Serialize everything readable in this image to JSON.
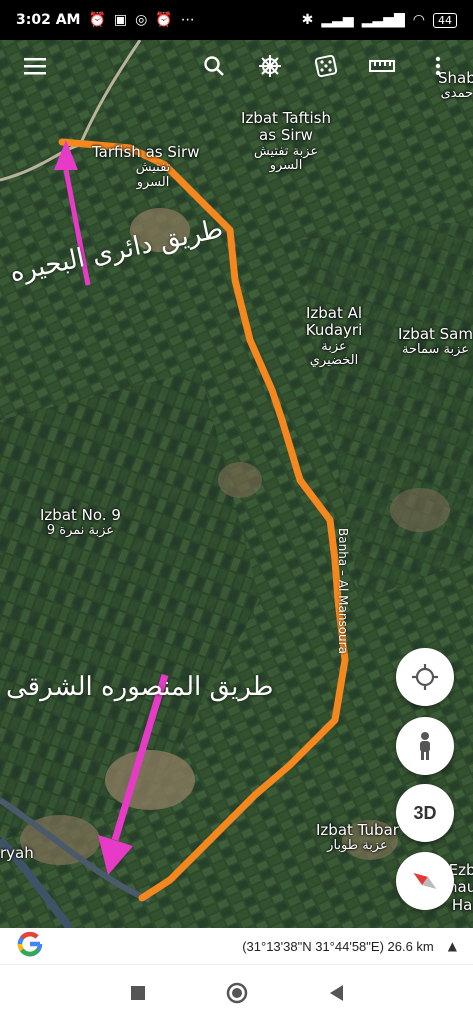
{
  "status": {
    "time": "3:02 AM",
    "left_icons": [
      "alarm-icon",
      "calendar-icon",
      "instagram-icon",
      "alarm-icon",
      "more-icon"
    ],
    "battery": "44"
  },
  "toolbar": {
    "menu": "menu-icon",
    "search": "search-icon",
    "voyager": "ship-wheel-icon",
    "feeling_lucky": "dice-icon",
    "measure": "ruler-icon",
    "more": "more-vert-icon"
  },
  "places": [
    {
      "en": "Tarfish as Sirw",
      "ar": "تفتيش السرو"
    },
    {
      "en": "Izbat Taftish as Sirw",
      "ar": "عزبة تفتيش السرو"
    },
    {
      "en": "Izbat Al Kudayri",
      "ar": "عزبة الخضيري"
    },
    {
      "en": "Izbat Sam",
      "ar": "عزبة سماحة"
    },
    {
      "en": "Izbat No. 9",
      "ar": "عزبة نمرة 9"
    },
    {
      "en": "Izbat Tubar",
      "ar": "عزبة طوبار"
    },
    {
      "en": "Shab",
      "ar": "حمدى"
    },
    {
      "en": "ryah",
      "ar": ""
    },
    {
      "en": "Ezb",
      "ar": ""
    },
    {
      "en": "hau",
      "ar": ""
    },
    {
      "en": "Ha",
      "ar": ""
    }
  ],
  "road_label": "Banha – Al Mansoura",
  "annotations": {
    "top": "طريق دائرى البحيره",
    "bottom": "طريق المنصوره الشرقى"
  },
  "controls": {
    "locate": "location-target-icon",
    "street_view": "pegman-icon",
    "three_d": "3D",
    "compass": "compass-icon"
  },
  "bottom": {
    "logo": "G",
    "coords": "(31°13'38\"N 31°44'58\"E) 26.6 km"
  },
  "colors": {
    "route": "#f5871f",
    "arrow": "#e63ac7",
    "map_base": "#2f4a2d"
  }
}
